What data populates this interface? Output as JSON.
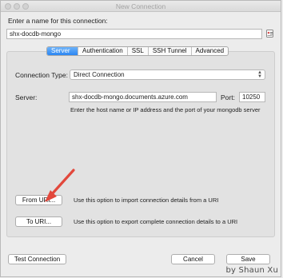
{
  "window": {
    "title": "New Connection"
  },
  "connection_name": {
    "label": "Enter a name for this connection:",
    "value": "shx-docdb-mongo",
    "icon": "address-card-icon"
  },
  "tabs": [
    {
      "label": "Server",
      "active": true
    },
    {
      "label": "Authentication",
      "active": false
    },
    {
      "label": "SSL",
      "active": false
    },
    {
      "label": "SSH Tunnel",
      "active": false
    },
    {
      "label": "Advanced",
      "active": false
    }
  ],
  "connection_type": {
    "label": "Connection Type:",
    "value": "Direct Connection"
  },
  "server": {
    "label": "Server:",
    "host_value": "shx-docdb-mongo.documents.azure.com",
    "port_label": "Port:",
    "port_value": "10250",
    "help_text": "Enter the host name or IP address and the port of your mongodb server"
  },
  "uri": {
    "from_label": "From URI...",
    "from_hint": "Use this option to import connection details from a URI",
    "to_label": "To URI...",
    "to_hint": "Use this option to export complete connection details to a URI"
  },
  "footer": {
    "test_label": "Test Connection",
    "cancel_label": "Cancel",
    "save_label": "Save"
  },
  "annotation": {
    "arrow_color": "#e2483c"
  },
  "watermark": "by Shaun Xu",
  "colors": {
    "accent": "#2b86f2",
    "background": "#ececec",
    "panel": "#e2e2e2"
  }
}
